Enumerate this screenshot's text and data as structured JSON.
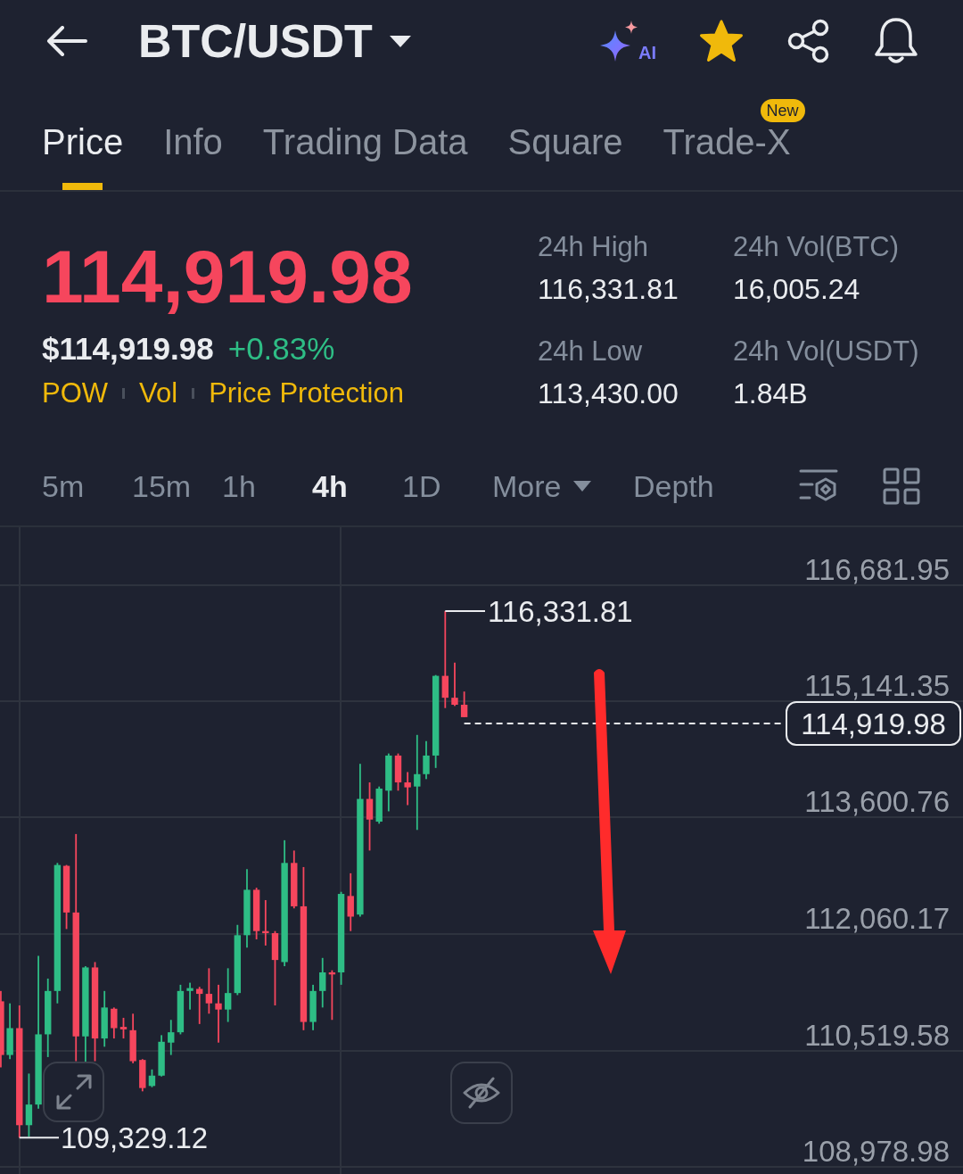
{
  "header": {
    "title": "BTC/USDT",
    "ai_label": "AI",
    "favorite": true
  },
  "tabs": [
    {
      "label": "Price",
      "selected": true
    },
    {
      "label": "Info",
      "selected": false
    },
    {
      "label": "Trading Data",
      "selected": false
    },
    {
      "label": "Square",
      "selected": false
    },
    {
      "label": "Trade-X",
      "selected": false,
      "badge": "New"
    }
  ],
  "ticker": {
    "last_price": "114,919.98",
    "usd_price": "$114,919.98",
    "change": "+0.83%",
    "tags": [
      "POW",
      "Vol",
      "Price Protection"
    ]
  },
  "stats": [
    {
      "label": "24h High",
      "value": "116,331.81"
    },
    {
      "label": "24h Vol(BTC)",
      "value": "16,005.24"
    },
    {
      "label": "24h Low",
      "value": "113,430.00"
    },
    {
      "label": "24h Vol(USDT)",
      "value": "1.84B"
    }
  ],
  "intervals": [
    {
      "label": "5m",
      "kind": "interval",
      "selected": false
    },
    {
      "label": "15m",
      "kind": "interval",
      "selected": false
    },
    {
      "label": "1h",
      "kind": "interval",
      "selected": false
    },
    {
      "label": "4h",
      "kind": "interval",
      "selected": true
    },
    {
      "label": "1D",
      "kind": "interval",
      "selected": false
    },
    {
      "label": "More",
      "kind": "dropdown",
      "selected": false
    },
    {
      "label": "Depth",
      "kind": "view",
      "selected": false
    }
  ],
  "chart": {
    "price_scale": [
      "116,681.95",
      "115,141.35",
      "113,600.76",
      "112,060.17",
      "110,519.58",
      "108,978.98"
    ],
    "high_marker": "116,331.81",
    "low_marker": "109,329.12",
    "last_price_tag": "114,919.98"
  }
}
